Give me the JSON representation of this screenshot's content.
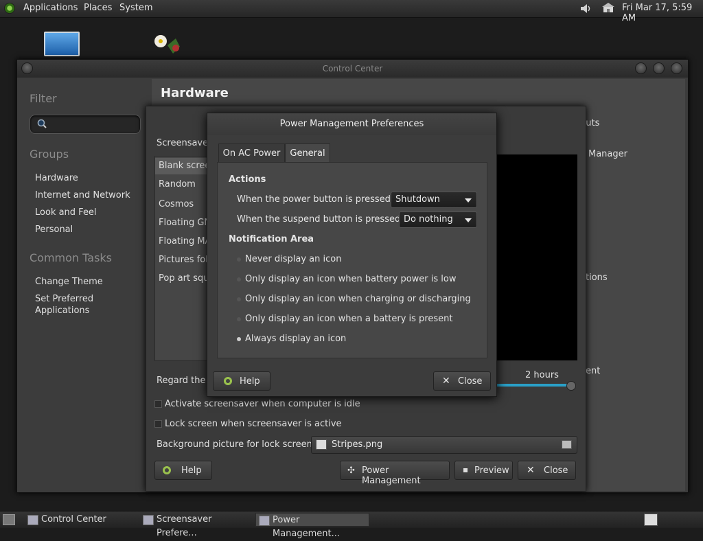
{
  "top_panel": {
    "menus": [
      "Applications",
      "Places",
      "System"
    ],
    "clock": "Fri Mar 17,  5:59 AM"
  },
  "control_center": {
    "title": "Control Center",
    "filter_heading": "Filter",
    "groups_heading": "Groups",
    "groups": [
      "Hardware",
      "Internet and Network",
      "Look and Feel",
      "Personal"
    ],
    "common_tasks_heading": "Common Tasks",
    "tasks": [
      "Change Theme",
      "Set Preferred",
      "Applications"
    ],
    "section_title": "Hardware",
    "right_items": [
      "tcuts",
      "Manager",
      "tions",
      "ent"
    ]
  },
  "screensaver": {
    "theme_label": "Screensaver",
    "themes": [
      "Blank screen",
      "Random",
      "Cosmos",
      "Floating GNOME",
      "Floating MATE",
      "Pictures folder",
      "Pop art squares"
    ],
    "regard_label": "Regard the c",
    "slider_value": "2 hours",
    "slider_fraction": 1.0,
    "activate_label": "Activate screensaver when computer is idle",
    "lock_label": "Lock screen when screensaver is active",
    "background_label": "Background picture for lock screen:",
    "background_file": "Stripes.png",
    "buttons": {
      "help": "Help",
      "power": "Power Management",
      "preview": "Preview",
      "close": "Close"
    }
  },
  "power_dialog": {
    "title": "Power Management Preferences",
    "tabs": [
      "On AC Power",
      "General"
    ],
    "active_tab": "General",
    "actions_heading": "Actions",
    "power_button_label": "When the power button is pressed:",
    "power_button_value": "Shutdown",
    "suspend_button_label": "When the suspend button is pressed:",
    "suspend_button_value": "Do nothing",
    "notification_heading": "Notification Area",
    "notification_options": [
      "Never display an icon",
      "Only display an icon when battery power is low",
      "Only display an icon when charging or discharging",
      "Only display an icon when a battery is present",
      "Always display an icon"
    ],
    "selected_option": 4,
    "help_label": "Help",
    "close_label": "Close"
  },
  "taskbar": {
    "items": [
      "Control Center",
      "Screensaver Prefere...",
      "Power Management..."
    ]
  }
}
